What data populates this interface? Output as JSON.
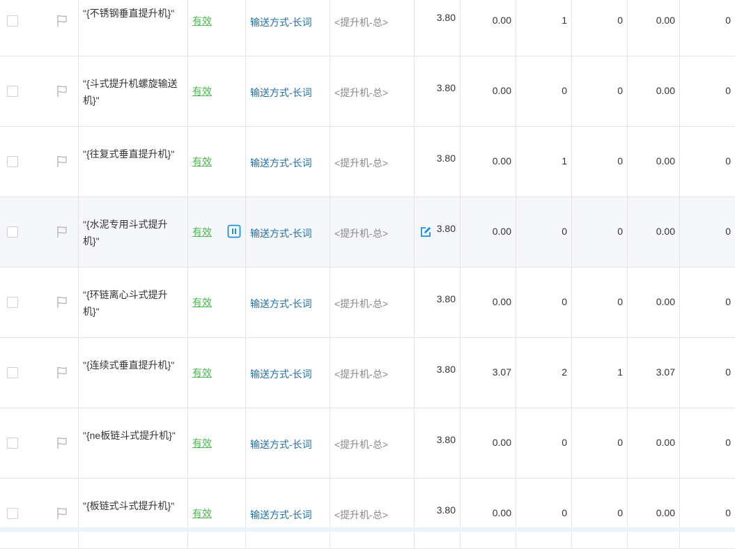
{
  "rows": [
    {
      "keyword": "\"{不锈钢垂直提升机}\"",
      "status": "有效",
      "plan": "输送方式-长词",
      "group": "<提升机-总>",
      "bid": "3.80",
      "n1": "0.00",
      "n2": "1",
      "n3": "0",
      "n4": "0.00",
      "n5": "0"
    },
    {
      "keyword": "\"{斗式提升机螺旋输送机}\"",
      "status": "有效",
      "plan": "输送方式-长词",
      "group": "<提升机-总>",
      "bid": "3.80",
      "n1": "0.00",
      "n2": "0",
      "n3": "0",
      "n4": "0.00",
      "n5": "0"
    },
    {
      "keyword": "\"{往复式垂直提升机}\"",
      "status": "有效",
      "plan": "输送方式-长词",
      "group": "<提升机-总>",
      "bid": "3.80",
      "n1": "0.00",
      "n2": "1",
      "n3": "0",
      "n4": "0.00",
      "n5": "0"
    },
    {
      "keyword": "\"{水泥专用斗式提升机}\"",
      "status": "有效",
      "plan": "输送方式-长词",
      "group": "<提升机-总>",
      "bid": "3.80",
      "n1": "0.00",
      "n2": "0",
      "n3": "0",
      "n4": "0.00",
      "n5": "0",
      "hover": true
    },
    {
      "keyword": "\"{环链离心斗式提升机}\"",
      "status": "有效",
      "plan": "输送方式-长词",
      "group": "<提升机-总>",
      "bid": "3.80",
      "n1": "0.00",
      "n2": "0",
      "n3": "0",
      "n4": "0.00",
      "n5": "0"
    },
    {
      "keyword": "\"{连续式垂直提升机}\"",
      "status": "有效",
      "plan": "输送方式-长词",
      "group": "<提升机-总>",
      "bid": "3.80",
      "n1": "3.07",
      "n2": "2",
      "n3": "1",
      "n4": "3.07",
      "n5": "0"
    },
    {
      "keyword": "\"{ne板链斗式提升机}\"",
      "status": "有效",
      "plan": "输送方式-长词",
      "group": "<提升机-总>",
      "bid": "3.80",
      "n1": "0.00",
      "n2": "0",
      "n3": "0",
      "n4": "0.00",
      "n5": "0"
    },
    {
      "keyword": "\"{板链式斗式提升机}\"",
      "status": "有效",
      "plan": "输送方式-长词",
      "group": "<提升机-总>",
      "bid": "3.80",
      "n1": "0.00",
      "n2": "0",
      "n3": "0",
      "n4": "0.00",
      "n5": "0"
    }
  ],
  "icons": {
    "flag": "flag-icon",
    "pause": "pause-icon",
    "edit": "edit-icon"
  },
  "colors": {
    "status": "#46b94a",
    "link": "#1d6fa8",
    "icon": "#1a8fe3",
    "muted": "#888888",
    "hover_row": "#f5f7fa",
    "border": "#e4e4e4"
  }
}
